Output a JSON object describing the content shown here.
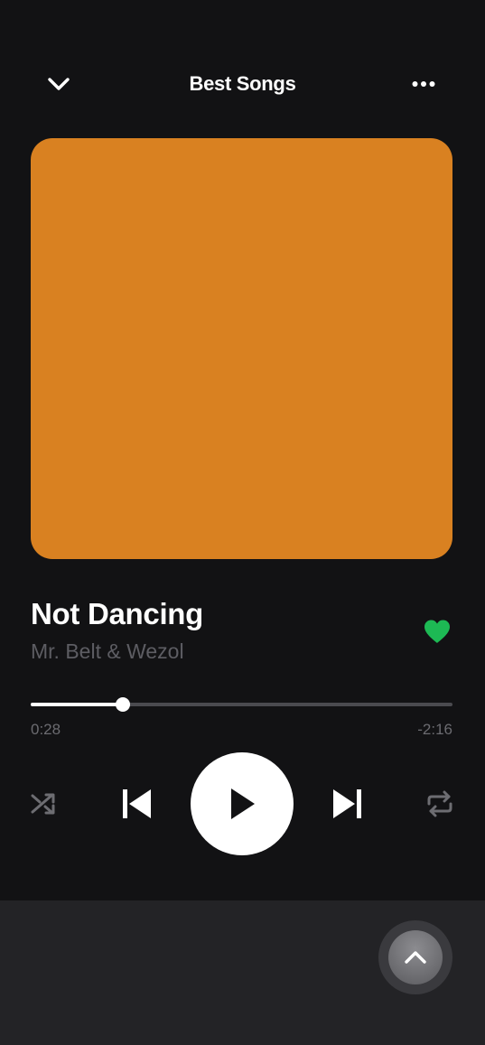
{
  "header": {
    "title": "Best Songs",
    "collapse_icon": "chevron-down-icon",
    "more_icon": "more-horizontal-icon"
  },
  "artwork": {
    "color": "#d98121"
  },
  "track": {
    "title": "Not Dancing",
    "artist": "Mr. Belt & Wezol",
    "liked": true,
    "like_color": "#1db954"
  },
  "progress": {
    "elapsed": "0:28",
    "remaining": "-2:16",
    "fraction": 0.218
  },
  "controls": {
    "shuffle_icon": "shuffle-icon",
    "previous_icon": "skip-previous-icon",
    "play_icon": "play-icon",
    "next_icon": "skip-next-icon",
    "repeat_icon": "repeat-icon"
  },
  "bottom_sheet": {
    "expand_icon": "chevron-up-icon"
  }
}
